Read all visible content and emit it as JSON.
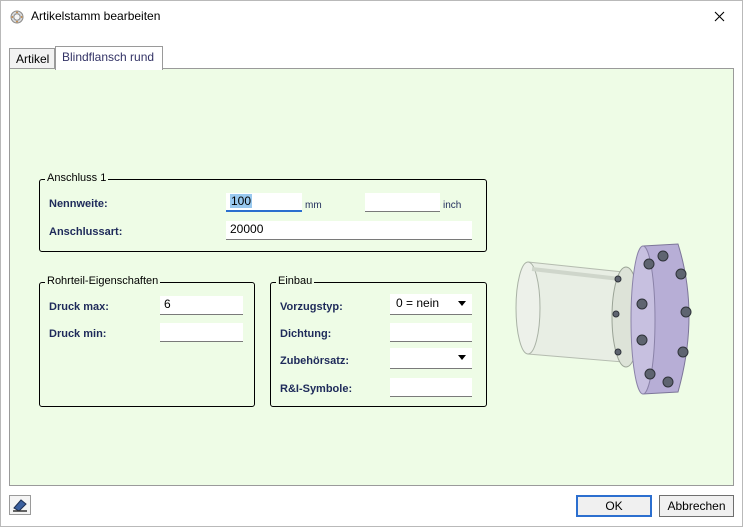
{
  "window": {
    "title": "Artikelstamm bearbeiten"
  },
  "tabs": [
    {
      "label": "Artikel",
      "active": false
    },
    {
      "label": "Blindflansch rund",
      "active": true
    }
  ],
  "anschluss": {
    "legend": "Anschluss 1",
    "nennweite_label": "Nennweite:",
    "nennweite_value": "100",
    "nennweite_unit": "mm",
    "inch_value": "",
    "inch_unit": "inch",
    "anschlussart_label": "Anschlussart:",
    "anschlussart_value": "20000"
  },
  "rohrteil": {
    "legend": "Rohrteil-Eigenschaften",
    "druck_max_label": "Druck max:",
    "druck_max_value": "6",
    "druck_min_label": "Druck min:",
    "druck_min_value": ""
  },
  "einbau": {
    "legend": "Einbau",
    "vorzugstyp_label": "Vorzugstyp:",
    "vorzugstyp_value": "0 = nein",
    "dichtung_label": "Dichtung:",
    "dichtung_value": "",
    "zubehoersatz_label": "Zubehörsatz:",
    "zubehoersatz_value": "",
    "ri_label": "R&I-Symbole:",
    "ri_value": ""
  },
  "buttons": {
    "ok": "OK",
    "cancel": "Abbrechen"
  },
  "colors": {
    "panel_bg": "#eefce6",
    "label_color": "#1e2a5a",
    "flange_color": "#b7aed6",
    "selection": "#99c9ef",
    "ok_border": "#2c6fcf"
  }
}
